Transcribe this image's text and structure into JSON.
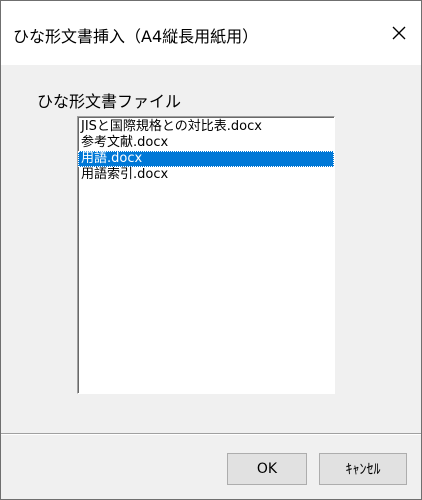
{
  "window": {
    "title": "ひな形文書挿入（A4縦長用紙用）",
    "close_icon": "close-icon"
  },
  "group": {
    "label": "ひな形文書ファイル"
  },
  "file_list": {
    "items": [
      {
        "label": "JISと国際規格との対比表.docx",
        "selected": false
      },
      {
        "label": "参考文献.docx",
        "selected": false
      },
      {
        "label": "用語.docx",
        "selected": true
      },
      {
        "label": "用語索引.docx",
        "selected": false
      }
    ]
  },
  "buttons": {
    "ok_label": "OK",
    "cancel_label": "ｷｬﾝｾﾙ"
  },
  "colors": {
    "selection": "#0078d7",
    "dialog_bg": "#f0f0f0",
    "titlebar_bg": "#ffffff"
  }
}
